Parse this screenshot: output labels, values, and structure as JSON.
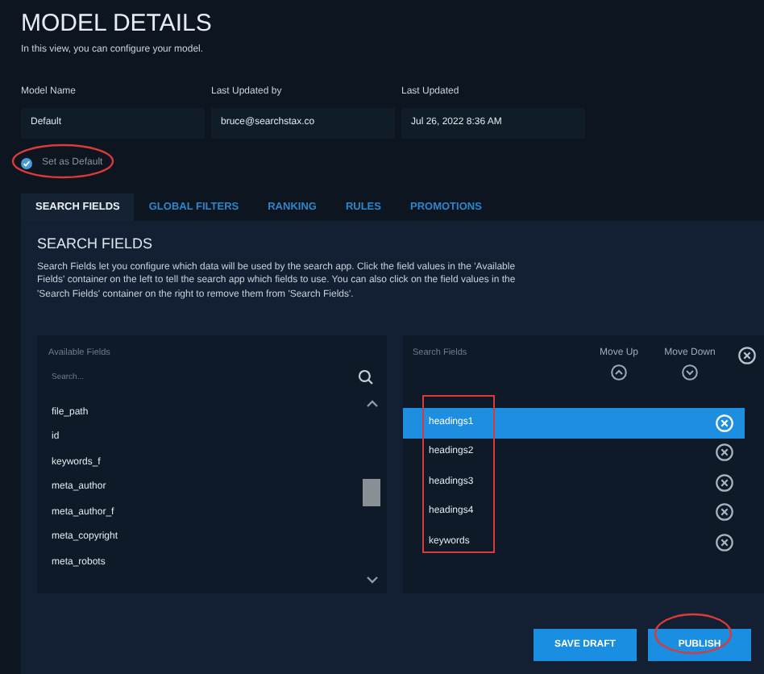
{
  "header": {
    "title": "MODEL DETAILS",
    "subtitle": "In this view, you can configure your model."
  },
  "fields": [
    {
      "label": "Model Name",
      "value": "Default"
    },
    {
      "label": "Last Updated by",
      "value": "bruce@searchstax.co"
    },
    {
      "label": "Last Updated",
      "value": "Jul 26, 2022 8:36 AM"
    }
  ],
  "set_default": {
    "label": "Set as Default",
    "checked": true
  },
  "tabs": [
    {
      "label": "SEARCH FIELDS",
      "selected": true
    },
    {
      "label": "GLOBAL FILTERS",
      "selected": false
    },
    {
      "label": "RANKING",
      "selected": false
    },
    {
      "label": "RULES",
      "selected": false
    },
    {
      "label": "PROMOTIONS",
      "selected": false
    }
  ],
  "section": {
    "title": "SEARCH FIELDS",
    "description": "Search Fields let you configure which data will be used by the search app. Click the field values in the 'Available Fields' container on the left to tell the search app which fields to use. You can also click on the field values in the 'Search Fields' container on the right to remove them from 'Search Fields'."
  },
  "available_fields": {
    "title": "Available Fields",
    "search": {
      "placeholder": "Search..."
    },
    "items": [
      "file_path",
      "id",
      "keywords_f",
      "meta_author",
      "meta_author_f",
      "meta_copyright",
      "meta_robots"
    ]
  },
  "search_fields": {
    "title": "Search Fields",
    "move_up": "Move Up",
    "move_down": "Move Down",
    "items": [
      {
        "name": "headings1",
        "selected": true
      },
      {
        "name": "headings2",
        "selected": false
      },
      {
        "name": "headings3",
        "selected": false
      },
      {
        "name": "headings4",
        "selected": false
      },
      {
        "name": "keywords",
        "selected": false
      }
    ]
  },
  "buttons": [
    "SAVE DRAFT",
    "PUBLISH"
  ]
}
